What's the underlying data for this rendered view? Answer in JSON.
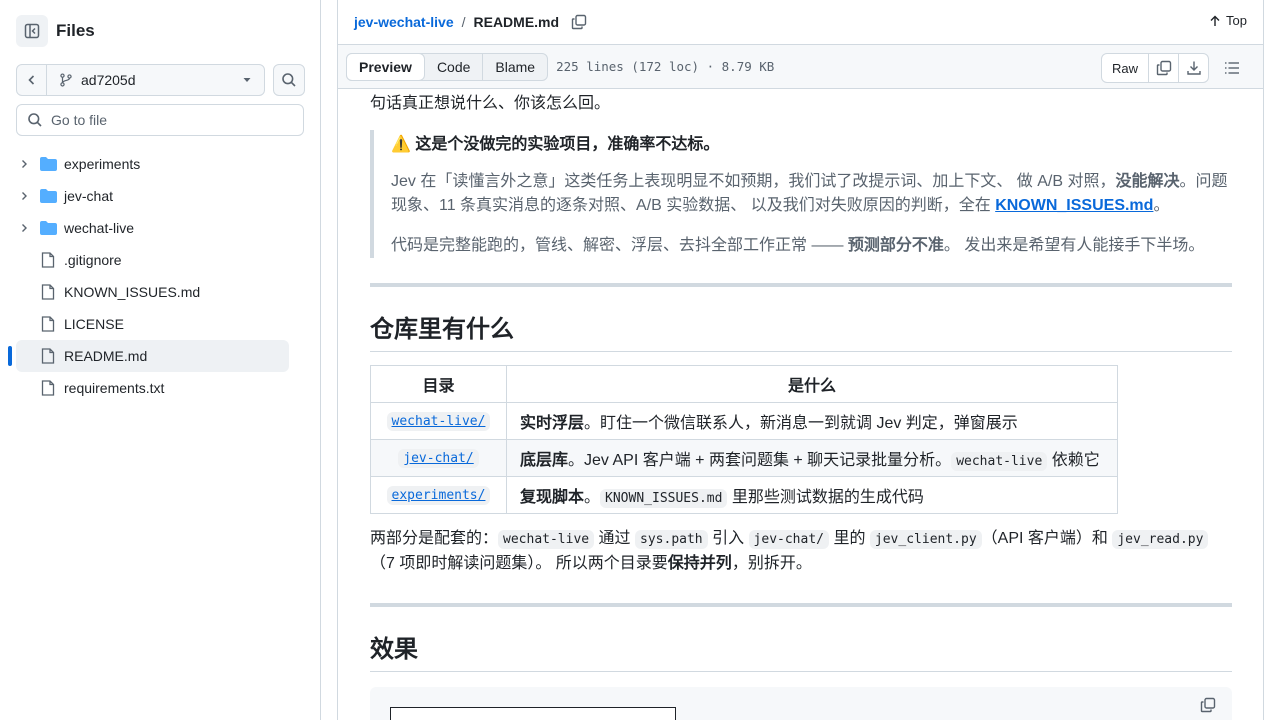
{
  "sidebar": {
    "title": "Files",
    "branch": "ad7205d",
    "goto_placeholder": "Go to file",
    "items": [
      {
        "label": "experiments",
        "type": "folder"
      },
      {
        "label": "jev-chat",
        "type": "folder"
      },
      {
        "label": "wechat-live",
        "type": "folder"
      },
      {
        "label": ".gitignore",
        "type": "file"
      },
      {
        "label": "KNOWN_ISSUES.md",
        "type": "file"
      },
      {
        "label": "LICENSE",
        "type": "file"
      },
      {
        "label": "README.md",
        "type": "file",
        "active": true
      },
      {
        "label": "requirements.txt",
        "type": "file"
      }
    ]
  },
  "header": {
    "repo": "jev-wechat-live",
    "separator": "/",
    "file": "README.md",
    "top_label": "Top"
  },
  "filebar": {
    "tabs": [
      "Preview",
      "Code",
      "Blame"
    ],
    "info": "225 lines (172 loc) · 8.79 KB",
    "raw": "Raw"
  },
  "readme": {
    "p_top": "句话真正想说什么、你该怎么回。",
    "warning_title": "⚠️ 这是个没做完的实验项目，准确率不达标。",
    "q1_a": "Jev 在「读懂言外之意」这类任务上表现明显不如预期，我们试了改提示词、加上下文、 做 A/B 对照，",
    "q1_bold": "没能解决",
    "q1_b": "。问题现象、11 条真实消息的逐条对照、A/B 实验数据、 以及我们对失败原因的判断，全在 ",
    "q1_link": "KNOWN_ISSUES.md",
    "q1_c": "。",
    "q2_a": "代码是完整能跑的，管线、解密、浮层、去抖全部工作正常 —— ",
    "q2_bold": "预测部分不准",
    "q2_b": "。 发出来是希望有人能接手下半场。",
    "h2_repo": "仓库里有什么",
    "table": {
      "headers": [
        "目录",
        "是什么"
      ],
      "rows": [
        {
          "dir": "wechat-live/",
          "bold": "实时浮层",
          "text": "。盯住一个微信联系人，新消息一到就调 Jev 判定，弹窗展示",
          "code": "",
          "tail": ""
        },
        {
          "dir": "jev-chat/",
          "bold": "底层库",
          "text": "。Jev API 客户端 + 两套问题集 + 聊天记录批量分析。",
          "code": "wechat-live",
          "tail": " 依赖它"
        },
        {
          "dir": "experiments/",
          "bold": "复现脚本",
          "text": "。",
          "code": "KNOWN_ISSUES.md",
          "tail": " 里那些测试数据的生成代码"
        }
      ]
    },
    "p_mid": {
      "a": "两部分是配套的：",
      "c1": "wechat-live",
      "b": " 通过 ",
      "c2": "sys.path",
      "c": " 引入 ",
      "c3": "jev-chat/",
      "d": " 里的 ",
      "c4": "jev_client.py",
      "e": "（API 客户端）和 ",
      "c5": "jev_read.py",
      "f": "（7 项即时解读问题集）。 所以两个目录要",
      "bold": "保持并列",
      "g": "，别拆开。"
    },
    "h2_effect": "效果"
  }
}
